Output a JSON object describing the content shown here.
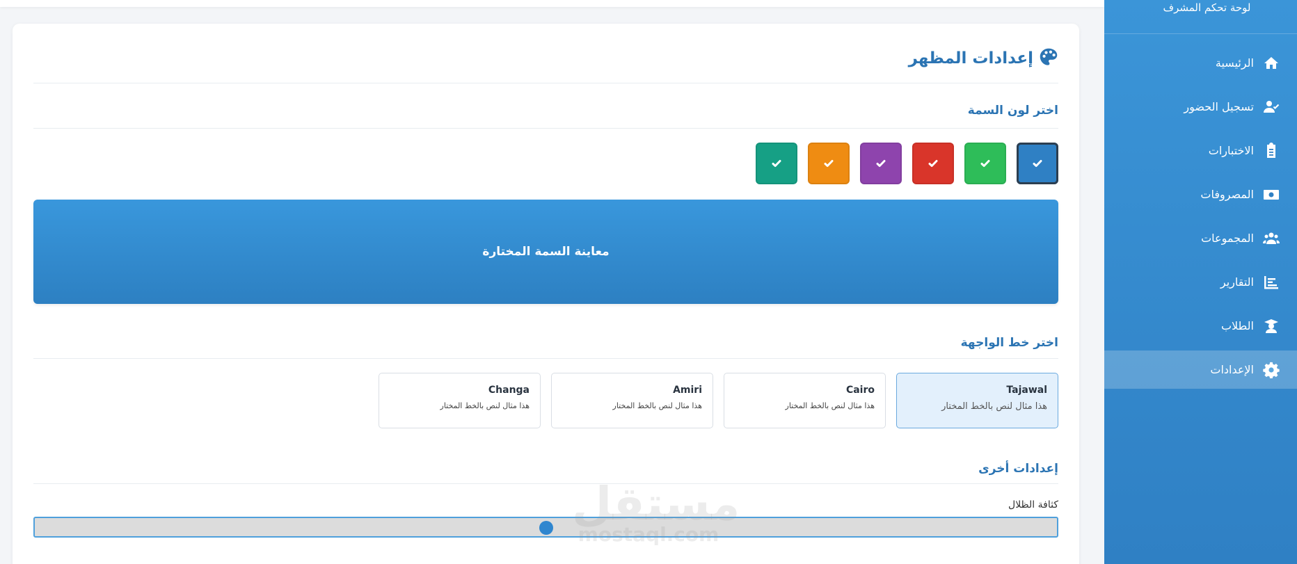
{
  "sidebar": {
    "brand": "لوحة تحكم المشرف",
    "items": [
      {
        "label": "الرئيسية",
        "icon": "home-icon",
        "active": false
      },
      {
        "label": "تسجيل الحضور",
        "icon": "user-check-icon",
        "active": false
      },
      {
        "label": "الاختبارات",
        "icon": "clipboard-list-icon",
        "active": false
      },
      {
        "label": "المصروفات",
        "icon": "money-bill-icon",
        "active": false
      },
      {
        "label": "المجموعات",
        "icon": "users-icon",
        "active": false
      },
      {
        "label": "التقارير",
        "icon": "chart-bar-icon",
        "active": false
      },
      {
        "label": "الطلاب",
        "icon": "graduate-icon",
        "active": false
      },
      {
        "label": "الإعدادات",
        "icon": "gear-icon",
        "active": true
      }
    ]
  },
  "page": {
    "title": "إعدادات المظهر",
    "title_icon": "palette-icon"
  },
  "theme_color": {
    "section_title": "اختر لون السمة",
    "colors": [
      {
        "name": "blue",
        "hex": "#2f80c4",
        "selected": true
      },
      {
        "name": "green",
        "hex": "#2ebd59",
        "selected": false
      },
      {
        "name": "red",
        "hex": "#d9352a",
        "selected": false
      },
      {
        "name": "purple",
        "hex": "#8e44ad",
        "selected": false
      },
      {
        "name": "orange",
        "hex": "#ef8c12",
        "selected": false
      },
      {
        "name": "teal",
        "hex": "#16a085",
        "selected": false
      }
    ],
    "preview_text": "معاينة السمة المختارة"
  },
  "font": {
    "section_title": "اختر خط الواجهة",
    "options": [
      {
        "name": "Tajawal",
        "sample": "هذا مثال لنص بالخط المختار",
        "selected": true
      },
      {
        "name": "Cairo",
        "sample": "هذا مثال لنص بالخط المختار",
        "selected": false
      },
      {
        "name": "Amiri",
        "sample": "هذا مثال لنص بالخط المختار",
        "selected": false
      },
      {
        "name": "Changa",
        "sample": "هذا مثال لنص بالخط المختار",
        "selected": false
      }
    ]
  },
  "other": {
    "section_title": "إعدادات أخرى",
    "shadow_label": "كثافة الظلال",
    "shadow_value": 0.5
  },
  "watermark": {
    "arabic": "مستقل",
    "english": "mostaql.com"
  }
}
